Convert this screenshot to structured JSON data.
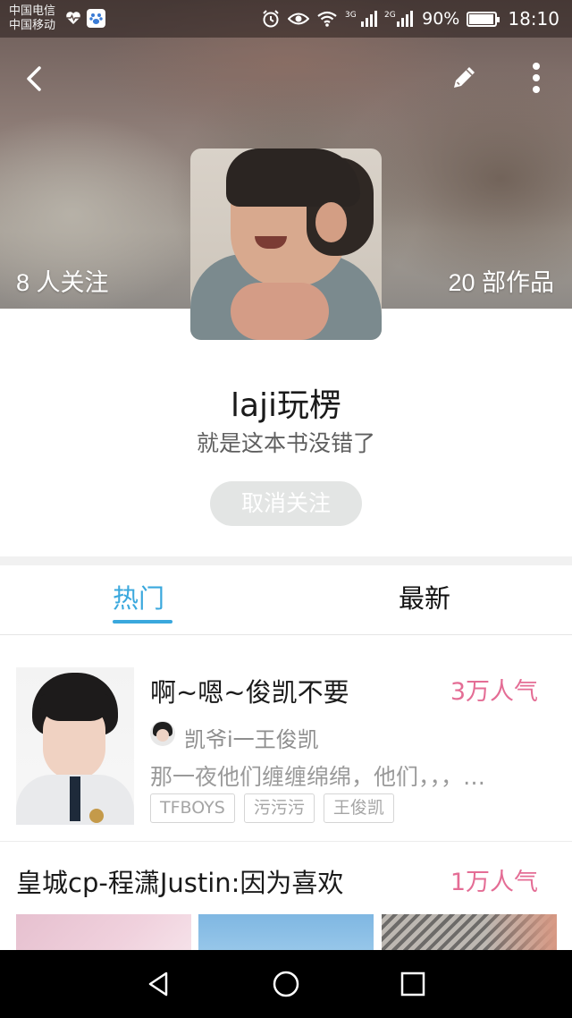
{
  "status_bar": {
    "carrier_1": "中国电信",
    "carrier_2": "中国移动",
    "network_1": "3G",
    "network_2": "2G",
    "battery": "90%",
    "time": "18:10",
    "icons": [
      "heart-rate-icon",
      "paw-app-icon",
      "alarm-icon",
      "eye-icon",
      "wifi-icon",
      "signal-icon",
      "battery-icon"
    ]
  },
  "header": {
    "follow_count": "8 人关注",
    "works_count": "20 部作品",
    "icons": [
      "back-icon",
      "edit-icon",
      "more-icon"
    ]
  },
  "profile": {
    "name": "laji玩楞",
    "bio": "就是这本书没错了",
    "unfollow_label": "取消关注"
  },
  "tabs": [
    {
      "label": "热门",
      "active": true
    },
    {
      "label": "最新",
      "active": false
    }
  ],
  "stories": [
    {
      "title": "啊~嗯~俊凯不要",
      "popularity": "3万人气",
      "author": "凯爷i一王俊凯",
      "excerpt": "那一夜他们缠缠绵绵，他们，，，…",
      "tags": [
        "TFBOYS",
        "污污污",
        "王俊凯"
      ]
    },
    {
      "title": "皇城cp-程潇Justin:因为喜欢",
      "popularity": "1万人气"
    }
  ],
  "colors": {
    "accent_blue": "#3aa8dd",
    "popularity_pink": "#e46d95",
    "button_gray": "#e3e5e4"
  },
  "navbar": {
    "icons": [
      "nav-back-icon",
      "nav-home-icon",
      "nav-recents-icon"
    ]
  }
}
